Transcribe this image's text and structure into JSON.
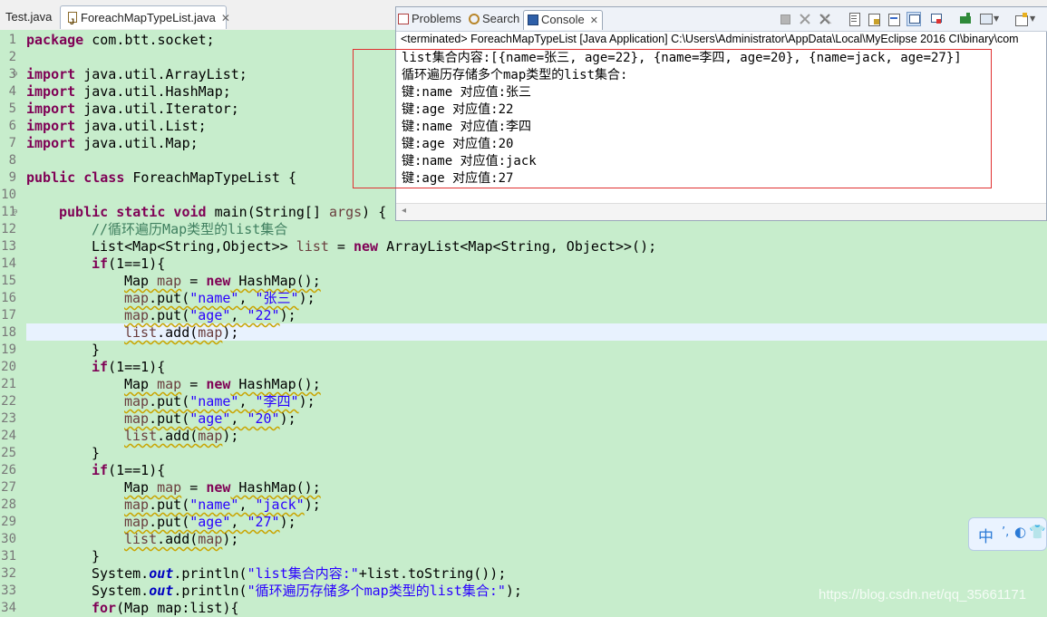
{
  "editor": {
    "tabs": [
      {
        "label": "Test.java"
      },
      {
        "label": "ForeachMapTypeList.java",
        "close": "✕"
      }
    ],
    "line_numbers": [
      "1",
      "2",
      "3",
      "4",
      "5",
      "6",
      "7",
      "8",
      "9",
      "10",
      "11",
      "12",
      "13",
      "14",
      "15",
      "16",
      "17",
      "18",
      "19",
      "20",
      "21",
      "22",
      "23",
      "24",
      "25",
      "26",
      "27",
      "28",
      "29",
      "30",
      "31",
      "32",
      "33",
      "34"
    ],
    "fold_markers": {
      "line3": "⊖",
      "line11": "⊖"
    },
    "code": {
      "l1": {
        "kw": "package",
        "rest": " com.btt.socket;"
      },
      "l3": {
        "kw": "import",
        "rest": " java.util.ArrayList;"
      },
      "l4": {
        "kw": "import",
        "rest": " java.util.HashMap;"
      },
      "l5": {
        "kw": "import",
        "rest": " java.util.Iterator;"
      },
      "l6": {
        "kw": "import",
        "rest": " java.util.List;"
      },
      "l7": {
        "kw": "import",
        "rest": " java.util.Map;"
      },
      "l9": {
        "kw": "public class",
        "rest": " ForeachMapTypeList {"
      },
      "l11": {
        "kw": "public static void",
        "mid": " main(String[] ",
        "var": "args",
        "rest": ") {"
      },
      "l12": {
        "comment": "//循环遍历Map类型的list集合"
      },
      "l13": {
        "a": "List<Map<String,Object>> ",
        "var": "list",
        "b": " = ",
        "kw": "new",
        "c": " ArrayList<Map<String, Object>>();"
      },
      "l14": {
        "kw": "if",
        "rest": "(1==1){"
      },
      "l15": {
        "a": "Map ",
        "var": "map",
        "b": " = ",
        "kw": "new",
        "c": " HashMap();"
      },
      "l16": {
        "var": "map",
        "a": ".put(",
        "s1": "\"name\"",
        "b": ", ",
        "s2": "\"张三\"",
        "c": ");"
      },
      "l17": {
        "var": "map",
        "a": ".put(",
        "s1": "\"age\"",
        "b": ", ",
        "s2": "\"22\"",
        "c": ");"
      },
      "l18": {
        "v1": "list",
        "a": ".add(",
        "v2": "map",
        "b": ");"
      },
      "l19": {
        "rest": "}"
      },
      "l20": {
        "kw": "if",
        "rest": "(1==1){"
      },
      "l21": {
        "a": "Map ",
        "var": "map",
        "b": " = ",
        "kw": "new",
        "c": " HashMap();"
      },
      "l22": {
        "var": "map",
        "a": ".put(",
        "s1": "\"name\"",
        "b": ", ",
        "s2": "\"李四\"",
        "c": ");"
      },
      "l23": {
        "var": "map",
        "a": ".put(",
        "s1": "\"age\"",
        "b": ", ",
        "s2": "\"20\"",
        "c": ");"
      },
      "l24": {
        "v1": "list",
        "a": ".add(",
        "v2": "map",
        "b": ");"
      },
      "l25": {
        "rest": "}"
      },
      "l26": {
        "kw": "if",
        "rest": "(1==1){"
      },
      "l27": {
        "a": "Map ",
        "var": "map",
        "b": " = ",
        "kw": "new",
        "c": " HashMap();"
      },
      "l28": {
        "var": "map",
        "a": ".put(",
        "s1": "\"name\"",
        "b": ", ",
        "s2": "\"jack\"",
        "c": ");"
      },
      "l29": {
        "var": "map",
        "a": ".put(",
        "s1": "\"age\"",
        "b": ", ",
        "s2": "\"27\"",
        "c": ");"
      },
      "l30": {
        "v1": "list",
        "a": ".add(",
        "v2": "map",
        "b": ");"
      },
      "l31": {
        "rest": "}"
      },
      "l32": {
        "a": "System.",
        "field": "out",
        "b": ".println(",
        "s": "\"list集合内容:\"",
        "c": "+list.toString());"
      },
      "l33": {
        "a": "System.",
        "field": "out",
        "b": ".println(",
        "s": "\"循环遍历存储多个map类型的list集合:\"",
        "c": ");"
      },
      "l34": {
        "kw": "for",
        "rest": "(Map map:list){"
      }
    }
  },
  "console": {
    "tabs": [
      {
        "label": "Problems"
      },
      {
        "label": "Search"
      },
      {
        "label": "Console",
        "close": "✕"
      }
    ],
    "terminated": "<terminated> ForeachMapTypeList [Java Application] C:\\Users\\Administrator\\AppData\\Local\\MyEclipse 2016 CI\\binary\\com",
    "output": [
      "list集合内容:[{name=张三, age=22}, {name=李四, age=20}, {name=jack, age=27}]",
      "循环遍历存储多个map类型的list集合:",
      "键:name 对应值:张三",
      "键:age 对应值:22",
      "键:name 对应值:李四",
      "键:age 对应值:20",
      "键:name 对应值:jack",
      "键:age 对应值:27"
    ],
    "scroll_left": "◂"
  },
  "ime": {
    "zh": "中",
    "dot": "’,",
    "moon": "◐",
    "shirt": "👕"
  },
  "watermark": "https://blog.csdn.net/qq_35661171"
}
